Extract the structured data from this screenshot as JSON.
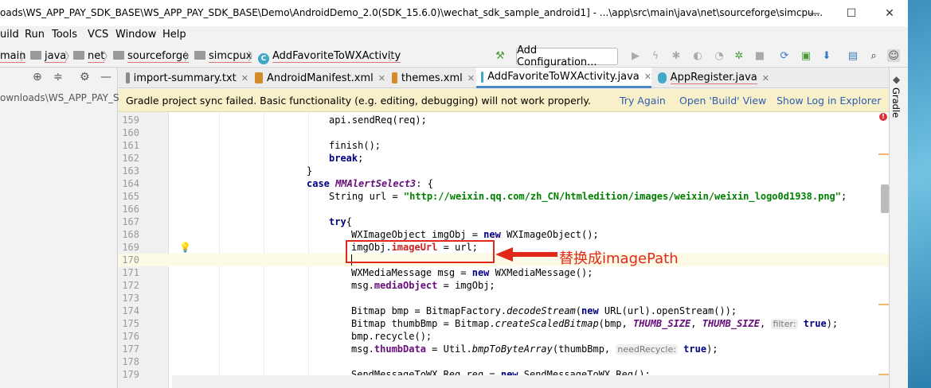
{
  "window": {
    "title": "oads\\WS_APP_PAY_SDK_BASE\\WS_APP_PAY_SDK_BASE\\Demo\\AndroidDemo_2.0(SDK_15.6.0)\\wechat_sdk_sample_android1] - ...\\app\\src\\main\\java\\net\\sourceforge\\simcpu...",
    "minimize": "—",
    "maximize": "☐",
    "close": "✕"
  },
  "menu": [
    "uild",
    "Run",
    "Tools",
    "VCS",
    "Window",
    "Help"
  ],
  "breadcrumb": [
    "main",
    "java",
    "net",
    "sourceforge",
    "simcpux",
    "AddFavoriteToWXActivity"
  ],
  "toolbar": {
    "add_config": "Add Configuration..."
  },
  "project": {
    "path": "ownloads\\WS_APP_PAY_S"
  },
  "tabs": [
    {
      "label": "import-summary.txt",
      "color": "#8a8a8a"
    },
    {
      "label": "AndroidManifest.xml",
      "color": "#d28b26"
    },
    {
      "label": "themes.xml",
      "color": "#d28b26"
    },
    {
      "label": "AddFavoriteToWXActivity.java",
      "color": "#40a9c9"
    },
    {
      "label": "AppRegister.java",
      "color": "#40a9c9"
    }
  ],
  "banner": {
    "message": "Gradle project sync failed. Basic functionality (e.g. editing, debugging) will not work properly.",
    "try_again": "Try Again",
    "open_build": "Open 'Build' View",
    "show_log": "Show Log in Explorer"
  },
  "gradle_panel": "Gradle",
  "annotation": {
    "text": "替换成imagePath"
  },
  "code": {
    "l159": {
      "num": "159",
      "a": "api.sendReq(req);"
    },
    "l160": {
      "num": "160"
    },
    "l161": {
      "num": "161",
      "a": "finish();"
    },
    "l162": {
      "num": "162",
      "kw": "break",
      "semi": ";"
    },
    "l163": {
      "num": "163",
      "a": "}"
    },
    "l164": {
      "num": "164",
      "kw": "case",
      "c": "MMAlertSelect3",
      "tail": ": {"
    },
    "l165": {
      "num": "165",
      "a": "String url = ",
      "s": "\"http://weixin.qq.com/zh_CN/htmledition/images/weixin/weixin_logo0d1938.png\"",
      "tail": ";"
    },
    "l166": {
      "num": "166"
    },
    "l167": {
      "num": "167",
      "kw": "try",
      "tail": "{"
    },
    "l168": {
      "num": "168",
      "a": "WXImageObject imgObj = ",
      "kw": "new",
      "tail": " WXImageObject();"
    },
    "l169": {
      "num": "169",
      "a": "imgObj.",
      "f": "imageUrl",
      "tail": " = url;"
    },
    "l170": {
      "num": "170"
    },
    "l171": {
      "num": "171",
      "a": "WXMediaMessage msg = ",
      "kw": "new",
      "tail": " WXMediaMessage();"
    },
    "l172": {
      "num": "172",
      "a": "msg.",
      "f": "mediaObject",
      "tail": " = imgObj;"
    },
    "l173": {
      "num": "173"
    },
    "l174": {
      "num": "174",
      "a": "Bitmap bmp = BitmapFactory.",
      "m": "decodeStream",
      "b": "(",
      "kw": "new",
      "tail": " URL(url).openStream());"
    },
    "l175": {
      "num": "175",
      "a": "Bitmap thumbBmp = Bitmap.",
      "m": "createScaledBitmap",
      "b": "(bmp, ",
      "c1": "THUMB_SIZE",
      "d": ", ",
      "c2": "THUMB_SIZE",
      "e": ", ",
      "hint": "filter:",
      "kw": "true",
      "tail": ");"
    },
    "l176": {
      "num": "176",
      "a": "bmp.recycle();"
    },
    "l177": {
      "num": "177",
      "a": "msg.",
      "f": "thumbData",
      "b": " = Util.",
      "m": "bmpToByteArray",
      "d": "(thumbBmp, ",
      "hint": "needRecycle:",
      "kw": "true",
      "tail": ");"
    },
    "l178": {
      "num": "178"
    },
    "l179": {
      "num": "179",
      "a": "SendMessageToWX.Req req = ",
      "kw": "new",
      "tail": " SendMessageToWX.Req();"
    }
  }
}
